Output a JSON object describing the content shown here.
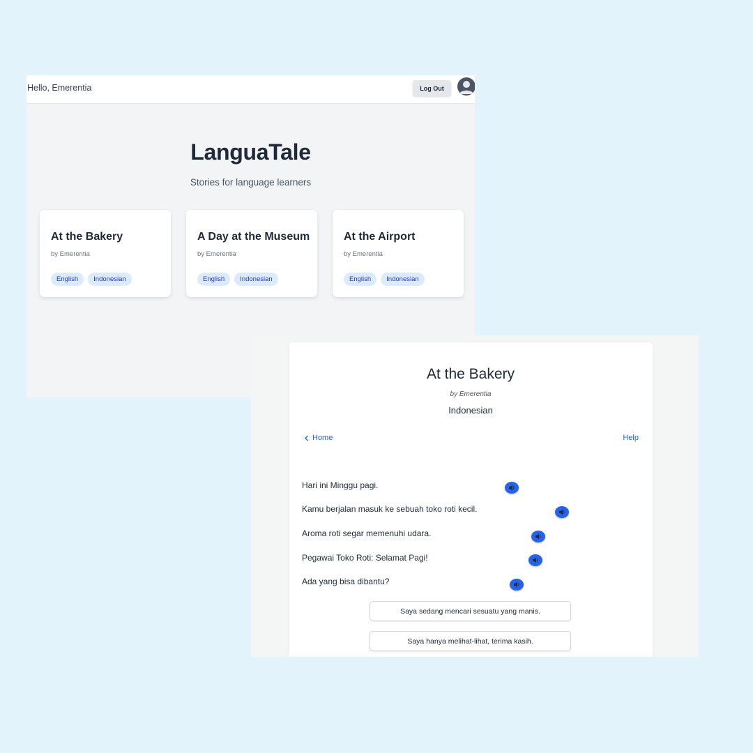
{
  "home": {
    "greeting": "Hello, Emerentia",
    "logout_label": "Log Out",
    "avatar_icon": "user-avatar-icon",
    "title": "LanguaTale",
    "subtitle": "Stories for language learners",
    "cards": [
      {
        "title": "At the Bakery",
        "author": "by Emerentia",
        "tags": [
          "English",
          "Indonesian"
        ]
      },
      {
        "title": "A Day at the Museum",
        "author": "by Emerentia",
        "tags": [
          "English",
          "Indonesian"
        ]
      },
      {
        "title": "At the Airport",
        "author": "by Emerentia",
        "tags": [
          "English",
          "Indonesian"
        ]
      }
    ]
  },
  "story": {
    "title": "At the Bakery",
    "author": "by Emerentia",
    "language": "Indonesian",
    "home_link": "Home",
    "help_link": "Help",
    "lines": [
      "Hari ini Minggu pagi.",
      "Kamu berjalan masuk ke sebuah toko roti kecil.",
      "Aroma roti segar memenuhi udara.",
      "Pegawai Toko Roti: Selamat Pagi!",
      "Ada yang bisa dibantu?"
    ],
    "audio_icon": "speaker-icon",
    "choices": [
      "Saya sedang mencari sesuatu yang manis.",
      "Saya hanya melihat-lihat, terima kasih."
    ]
  },
  "colors": {
    "background": "#e3f3fc",
    "accent": "#2563eb",
    "tag_bg": "#dbeafe",
    "tag_text": "#1e40af"
  }
}
